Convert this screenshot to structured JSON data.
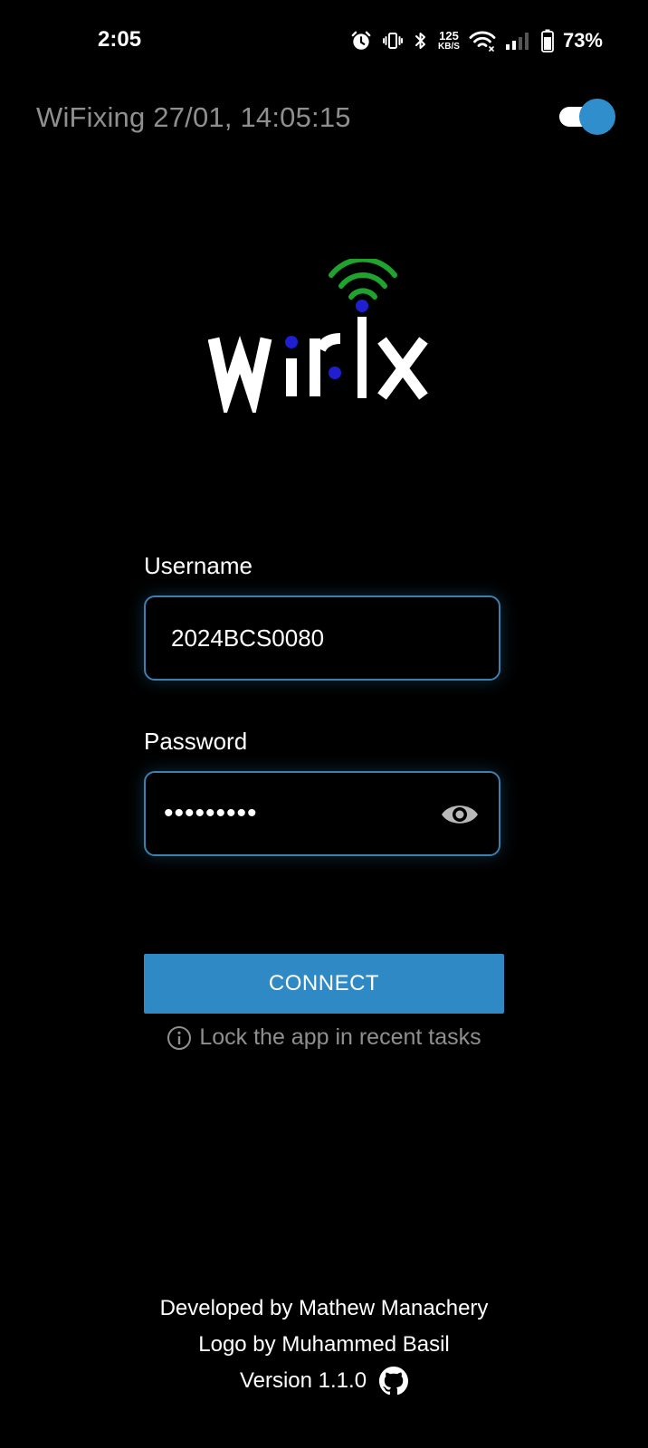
{
  "status_bar": {
    "time": "2:05",
    "net_speed_value": "125",
    "net_speed_unit": "KB/S",
    "battery_percent": "73%",
    "icons": [
      "alarm-icon",
      "vibrate-icon",
      "bluetooth-icon",
      "wifi-icon",
      "signal-icon",
      "battery-icon"
    ]
  },
  "header": {
    "title": "WiFixing 27/01, 14:05:15",
    "toggle_on": true
  },
  "logo": {
    "text": "wifix"
  },
  "form": {
    "username_label": "Username",
    "username_value": "2024BCS0080",
    "password_label": "Password",
    "password_value": "•••••••••"
  },
  "connect_button": {
    "label": "CONNECT"
  },
  "hint": {
    "text": "Lock the app in recent tasks"
  },
  "footer": {
    "developer": "Developed by Mathew Manachery",
    "logo_credit": "Logo by Muhammed Basil",
    "version": "Version 1.1.0"
  },
  "colors": {
    "accent": "#2f89c4",
    "field_border": "#3e7fae",
    "muted_text": "#8f8f8f",
    "logo_signal": "#1fa22e",
    "logo_dot": "#1f1fd1",
    "background": "#000000"
  }
}
